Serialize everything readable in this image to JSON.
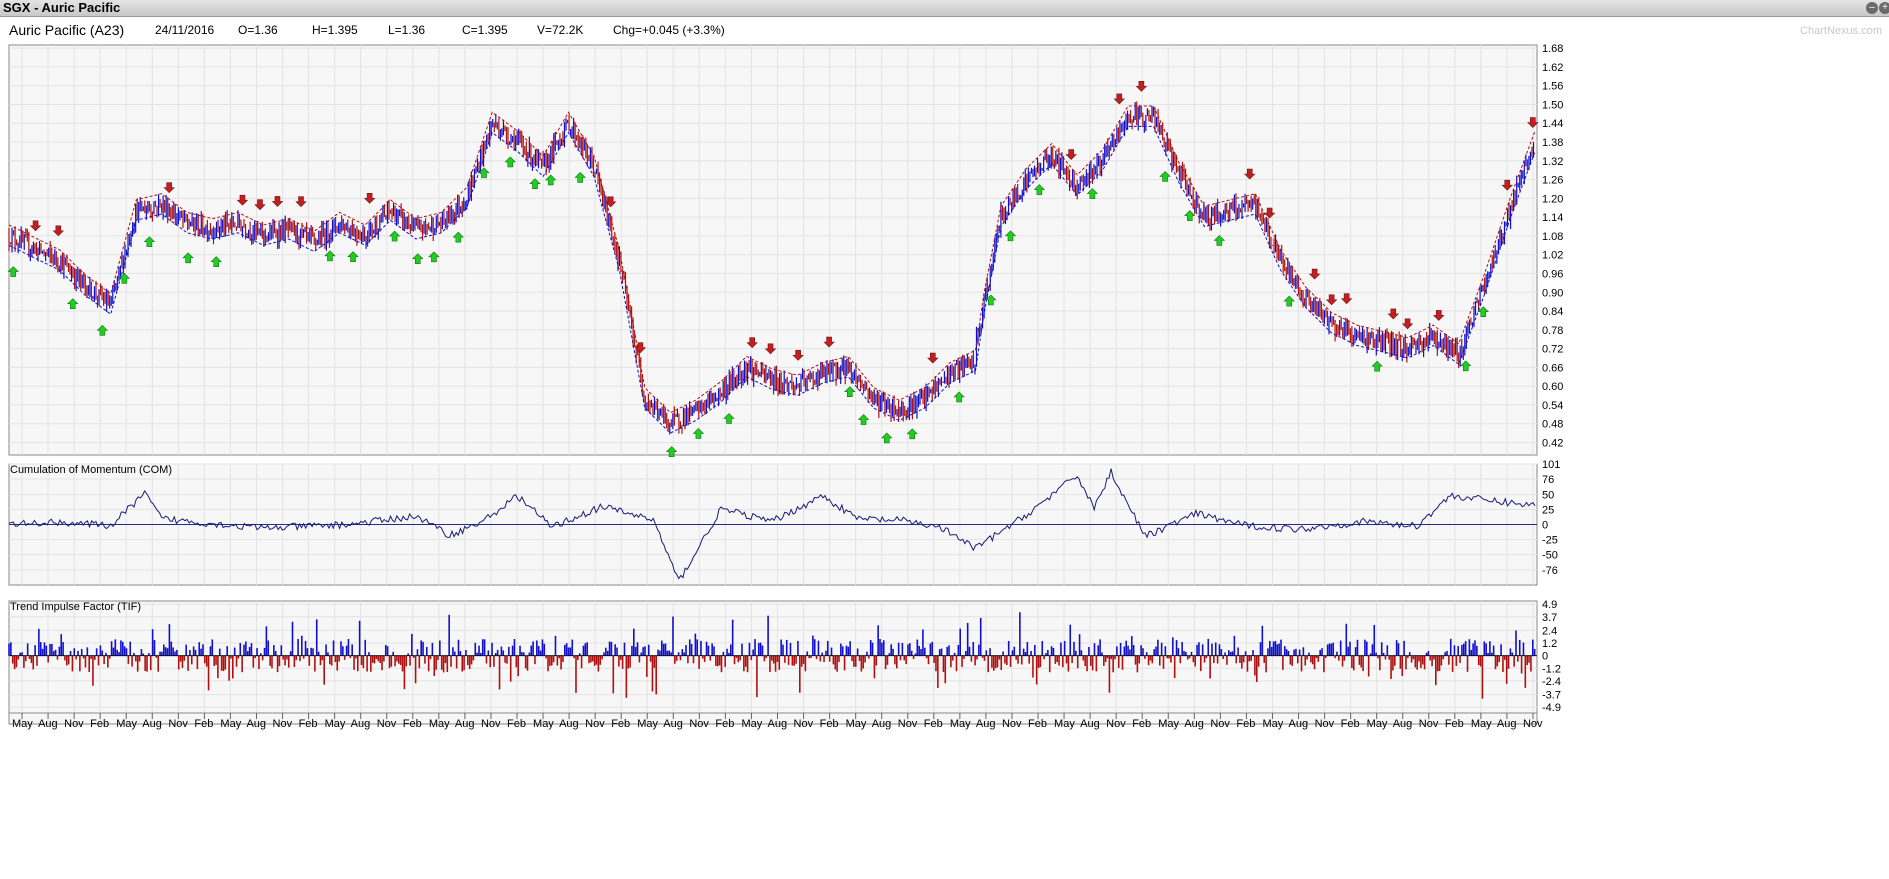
{
  "window": {
    "title": "SGX - Auric Pacific",
    "minimize_glyph": "–",
    "maximize_glyph": "+"
  },
  "header": {
    "name": "Auric Pacific (A23)",
    "date": "24/11/2016",
    "open": "O=1.36",
    "high": "H=1.395",
    "low": "L=1.36",
    "close": "C=1.395",
    "volume": "V=72.2K",
    "change": "Chg=+0.045 (+3.3%)",
    "watermark": "ChartNexus.com"
  },
  "colors": {
    "up": "#1010cc",
    "down": "#b01010",
    "arrow_buy": "#22cc22",
    "arrow_sell": "#c02020",
    "com_line": "#1a1a7a",
    "grid": "#e3e3e3",
    "panel_bg": "#f7f7f7"
  },
  "chart_data": [
    {
      "type": "line",
      "title": "",
      "description_series": "price (candlestick-style), with buy/sell arrows",
      "ylim": [
        0.38,
        1.69
      ],
      "yticks": [
        "1.68",
        "1.62",
        "1.56",
        "1.50",
        "1.44",
        "1.38",
        "1.32",
        "1.26",
        "1.20",
        "1.14",
        "1.08",
        "1.02",
        "0.96",
        "0.90",
        "0.84",
        "0.78",
        "0.72",
        "0.66",
        "0.60",
        "0.54",
        "0.48",
        "0.42"
      ],
      "x": [
        0,
        3,
        6,
        9,
        12,
        15,
        18,
        21,
        24,
        27,
        30,
        33,
        36,
        39,
        42,
        45,
        48,
        51,
        54,
        57,
        60,
        63,
        66,
        69,
        72,
        75,
        78,
        81,
        84,
        87,
        90,
        93,
        96,
        99,
        102,
        105,
        108,
        111,
        114
      ],
      "y": [
        1.08,
        1.04,
        1.0,
        0.92,
        0.86,
        1.16,
        1.18,
        1.12,
        1.1,
        1.12,
        1.08,
        1.1,
        1.06,
        1.12,
        1.08,
        1.16,
        1.1,
        1.12,
        1.2,
        1.44,
        1.38,
        1.3,
        1.44,
        1.3,
        1.0,
        0.56,
        0.48,
        0.52,
        0.58,
        0.66,
        0.62,
        0.6,
        0.64,
        0.66,
        0.56,
        0.52,
        0.56,
        0.64,
        0.68
      ],
      "x2": [
        114,
        117,
        120,
        123,
        126,
        129,
        132,
        135,
        138,
        141,
        144,
        147,
        150,
        153,
        156,
        159,
        162,
        165,
        168,
        171,
        174,
        177,
        180
      ],
      "y2": [
        0.72,
        1.14,
        1.26,
        1.34,
        1.24,
        1.32,
        1.46,
        1.46,
        1.28,
        1.14,
        1.16,
        1.18,
        1.0,
        0.88,
        0.8,
        0.76,
        0.74,
        0.72,
        0.76,
        0.7,
        0.92,
        1.16,
        1.38
      ]
    },
    {
      "type": "line",
      "title": "Cumulation of Momentum (COM)",
      "ylim": [
        -101,
        101
      ],
      "yticks": [
        "101",
        "76",
        "50",
        "25",
        "0",
        "-25",
        "-50",
        "-76"
      ],
      "x": [
        0,
        6,
        12,
        16,
        18,
        22,
        30,
        40,
        48,
        52,
        56,
        60,
        64,
        70,
        76,
        79,
        84,
        90,
        96,
        100,
        106,
        110,
        114,
        120,
        126,
        128,
        130,
        134,
        140,
        146,
        152,
        160,
        166,
        170,
        176,
        180
      ],
      "y": [
        0,
        4,
        -2,
        52,
        10,
        4,
        -6,
        0,
        14,
        -18,
        6,
        48,
        -4,
        30,
        8,
        -95,
        26,
        5,
        48,
        10,
        6,
        -6,
        -40,
        16,
        82,
        28,
        88,
        -20,
        18,
        -2,
        -8,
        5,
        -3,
        48,
        38,
        32
      ]
    },
    {
      "type": "bar",
      "title": "Trend Impulse Factor (TIF)",
      "ylim": [
        -6.5,
        5.2
      ],
      "yticks": [
        "4.9",
        "3.7",
        "2.4",
        "1.2",
        "0",
        "-1.2",
        "-2.4",
        "-3.7",
        "-4.9"
      ]
    }
  ],
  "x_axis": {
    "labels": [
      "May",
      "Aug",
      "Nov",
      "Feb",
      "May",
      "Aug",
      "Nov",
      "Feb",
      "May",
      "Aug",
      "Nov",
      "Feb",
      "May",
      "Aug",
      "Nov",
      "Feb",
      "May",
      "Aug",
      "Nov",
      "Feb",
      "May",
      "Aug",
      "Nov",
      "Feb",
      "May",
      "Aug",
      "Nov",
      "Feb",
      "May",
      "Aug",
      "Nov",
      "Feb",
      "May",
      "Aug",
      "Nov",
      "Feb",
      "May",
      "Aug",
      "Nov",
      "Feb",
      "May",
      "Aug",
      "Nov",
      "Feb",
      "May",
      "Aug",
      "Nov",
      "Feb",
      "May",
      "Aug",
      "Nov",
      "Feb",
      "May",
      "Aug",
      "Nov",
      "Feb",
      "May",
      "Aug",
      "Nov"
    ]
  }
}
